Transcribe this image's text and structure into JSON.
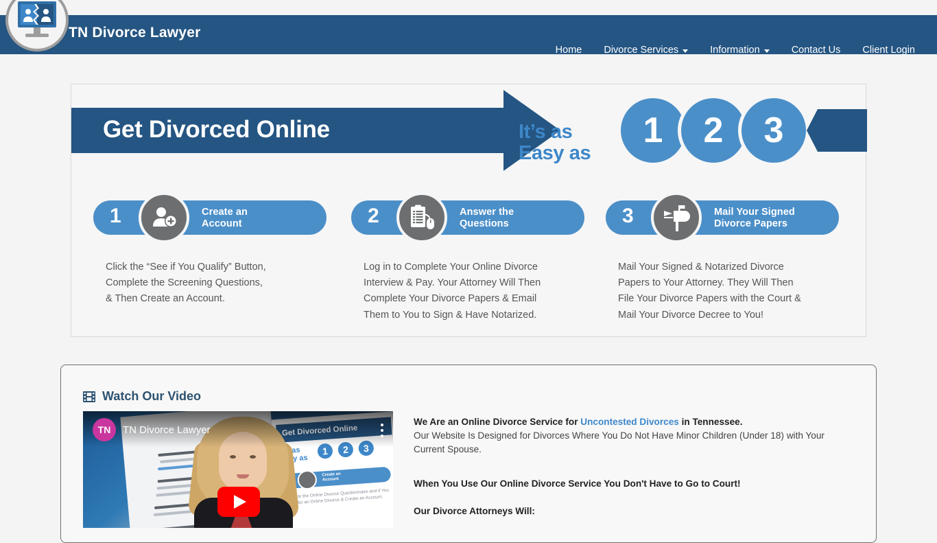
{
  "header": {
    "brand": "TN Divorce Lawyer",
    "logo_icon": "divorce-monitor-icon",
    "nav": [
      {
        "label": "Home",
        "caret": false
      },
      {
        "label": "Divorce Services",
        "caret": true
      },
      {
        "label": "Information",
        "caret": true
      },
      {
        "label": "Contact Us",
        "caret": false
      },
      {
        "label": "Client Login",
        "caret": false
      }
    ]
  },
  "banner": {
    "title": "Get Divorced Online",
    "easy_line1": "It’s as",
    "easy_line2": "Easy as",
    "numbers": [
      "1",
      "2",
      "3"
    ]
  },
  "steps": [
    {
      "number": "1",
      "icon": "add-user-icon",
      "label_line1": "Create an",
      "label_line2": "Account",
      "description": "Click the “See if You Qualify” Button,\nComplete the Screening Questions,\n& Then Create an Account."
    },
    {
      "number": "2",
      "icon": "clipboard-mouse-icon",
      "label_line1": "Answer the",
      "label_line2": "Questions",
      "description": "Log in to Complete Your Online Divorce\nInterview & Pay. Your Attorney Will Then\nComplete Your Divorce Papers & Email\nThem to You to Sign & Have Notarized."
    },
    {
      "number": "3",
      "icon": "mailbox-icon",
      "label_line1": "Mail Your Signed",
      "label_line2": "Divorce Papers",
      "description": "Mail Your Signed & Notarized Divorce\nPapers to Your Attorney. They Will Then\nFile Your Divorce Papers with the Court &\nMail Your Divorce Decree to You!"
    }
  ],
  "video_section": {
    "heading": "Watch Our Video",
    "heading_icon": "film-strip-icon",
    "player": {
      "avatar_initials": "TN",
      "title": "TN Divorce Lawyer",
      "menu_icon": "kebab-menu-icon",
      "play_icon": "youtube-play-icon",
      "thumbnail_banner": "Get Divorced Online",
      "thumbnail_easy1": "It's as",
      "thumbnail_easy2": "Easy as",
      "thumbnail_nums": [
        "1",
        "2",
        "3"
      ],
      "thumbnail_pill1": "Create an",
      "thumbnail_pill2": "Account",
      "thumbnail_body": "Complete the Online Divorce Questionnaire and if You Qualify for an Online Divorce & Create an Account."
    },
    "copy": {
      "line1_pre": "We Are an Online Divorce Service for ",
      "line1_link": "Uncontested Divorces",
      "line1_post": " in Tennessee.",
      "line2": "Our Website Is Designed for Divorces Where You Do Not Have Minor Children (Under 18) with Your Current Spouse.",
      "line3": "When You Use Our Online Divorce Service You Don't Have to Go to Court!",
      "line4": "Our Divorce Attorneys Will:"
    }
  },
  "colors": {
    "header_blue": "#255582",
    "accent_blue": "#4b8fc9",
    "gray_circle": "#6d6e70",
    "link_blue": "#3d87c9",
    "youtube_red": "#ff0000",
    "avatar_pink": "#c9379e"
  }
}
